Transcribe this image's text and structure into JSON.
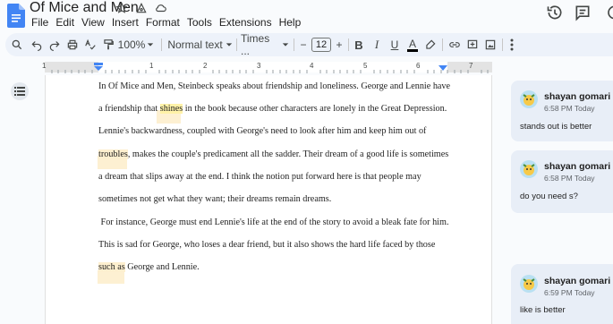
{
  "document": {
    "title": "Of Mice and Men"
  },
  "menu": [
    "File",
    "Edit",
    "View",
    "Insert",
    "Format",
    "Tools",
    "Extensions",
    "Help"
  ],
  "toolbar": {
    "zoom": "100%",
    "style": "Normal text",
    "font": "Times ...",
    "font_size": "12",
    "minus": "−",
    "plus": "+",
    "bold": "B",
    "italic": "I",
    "underline": "U",
    "text_color": "A"
  },
  "ruler": {
    "numbers": [
      "1",
      "1",
      "2",
      "3",
      "4",
      "5",
      "6",
      "7"
    ]
  },
  "body": {
    "lines": [
      {
        "pre": "In Of Mice and Men, Steinbeck speaks about friendship and loneliness. George and Lennie have",
        "hl": "",
        "post": ""
      },
      {
        "pre": "a friendship that ",
        "hl": "shines",
        "post": " in the book because other characters are lonely in the Great Depression."
      },
      {
        "pre": "Lennie's backwardness, coupled with George's need to look after him and keep him out of",
        "hl": "",
        "post": ""
      },
      {
        "pre": "",
        "hl": "troubles",
        "post": ", makes the couple's predicament all the sadder. Their dream of a good life is sometimes"
      },
      {
        "pre": "a dream that slips away at the end. I think the notion put forward here is that people may",
        "hl": "",
        "post": ""
      },
      {
        "pre": "sometimes not get what they want; their dreams remain dreams.",
        "hl": "",
        "post": ""
      },
      {
        "pre": " For instance, George must end Lennie's life at the end of the story to avoid a bleak fate for him.",
        "hl": "",
        "post": ""
      },
      {
        "pre": "This is sad for George, who loses a dear friend, but it also shows the hard life faced by those",
        "hl": "",
        "post": ""
      },
      {
        "pre": "",
        "hl": "such as",
        "post": " George and Lennie."
      }
    ]
  },
  "comments": [
    {
      "author": "shayan gomari",
      "time": "6:58 PM Today",
      "text": "stands out is better"
    },
    {
      "author": "shayan gomari",
      "time": "6:58 PM Today",
      "text": "do you need s?"
    },
    {
      "author": "shayan gomari",
      "time": "6:59 PM Today",
      "text": "like is better"
    }
  ],
  "colors": {
    "accent": "#4285f4",
    "toolbar_bg": "#edf2fa",
    "highlight": "#fff2a8",
    "comment_bg": "#e8eef7"
  }
}
